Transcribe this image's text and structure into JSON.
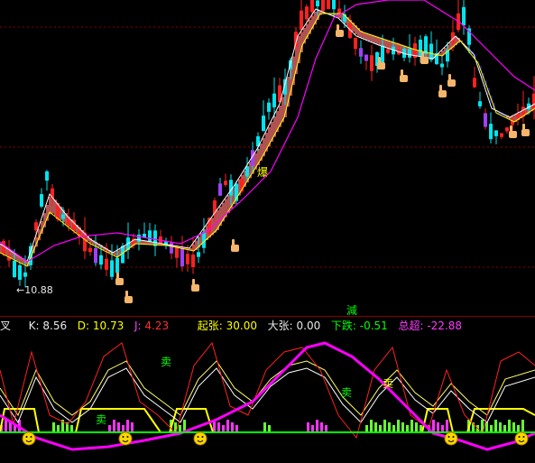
{
  "chart": {
    "low_price_label": "10.88",
    "burst_label": "爆",
    "cross_label": "減",
    "indicator_name": "叉",
    "k_label": "K:",
    "k_value": "8.56",
    "d_label": "D:",
    "d_value": "10.73",
    "j_label": "J:",
    "j_value": "4.23",
    "qizhang_label": "起张:",
    "qizhang_value": "30.00",
    "dazhang_label": "大张:",
    "dazhang_value": "0.00",
    "xiadie_label": "下跌:",
    "xiadie_value": "-0.51",
    "zongchao_label": "总超:",
    "zongchao_value": "-22.88",
    "signals": [
      "卖",
      "卖",
      "卖",
      "卖"
    ]
  },
  "colors": {
    "background": "#000000",
    "up_candle": "#ff2020",
    "down_candle": "#00e5ee",
    "magenta": "#ff00ff",
    "white_line": "#ffffff",
    "yellow": "#ffff00",
    "green": "#00ff00",
    "grid": "#8a0000"
  },
  "icons": [
    "pointing-hand-icon",
    "smiley-icon"
  ]
}
